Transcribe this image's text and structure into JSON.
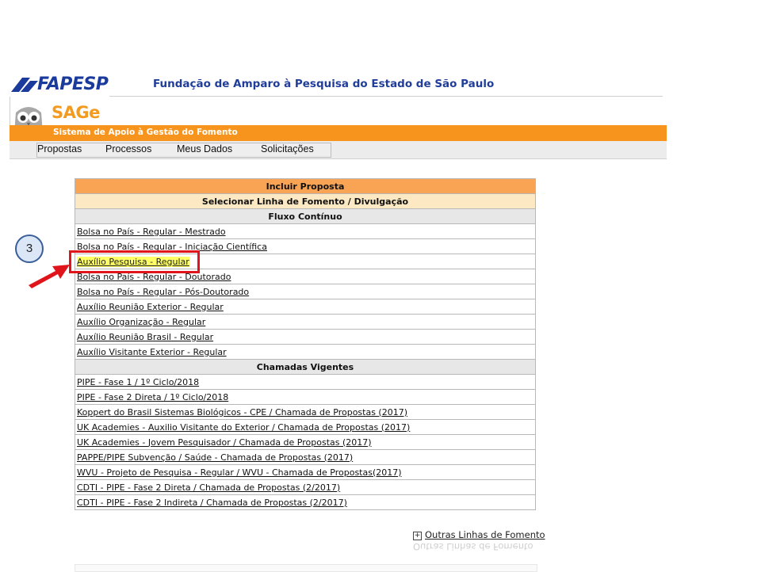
{
  "header": {
    "logo_text": "FAPESP",
    "foundation_title": "Fundação de Amparo à Pesquisa do Estado de São Paulo",
    "app_name": "SAGe",
    "app_subtitle": "Sistema de Apoio à Gestão do Fomento"
  },
  "menu": {
    "items": [
      "Propostas",
      "Processos",
      "Meus Dados",
      "Solicitações"
    ]
  },
  "table": {
    "title": "Incluir Proposta",
    "subtitle": "Selecionar Linha de Fomento / Divulgação",
    "section_fluxo": "Fluxo Contínuo",
    "fluxo_items": [
      "Bolsa no País - Regular - Mestrado",
      "Bolsa no País - Regular - Iniciação Científica",
      "Auxílio Pesquisa - Regular",
      "Bolsa no País - Regular - Doutorado",
      "Bolsa no País - Regular - Pós-Doutorado",
      "Auxílio Reunião Exterior - Regular",
      "Auxílio Organização - Regular",
      "Auxílio Reunião Brasil - Regular",
      "Auxílio Visitante Exterior - Regular"
    ],
    "section_chamadas": "Chamadas Vigentes",
    "chamadas_items": [
      "PIPE - Fase 1 / 1º Ciclo/2018",
      "PIPE - Fase 2 Direta / 1º Ciclo/2018",
      "Koppert do Brasil Sistemas Biológicos - CPE / Chamada de Propostas (2017)",
      "UK Academies - Auxilio Visitante do Exterior / Chamada de Propostas (2017)",
      "UK Academies - Jovem Pesquisador / Chamada de Propostas (2017)",
      "PAPPE/PIPE Subvenção / Saúde - Chamada de Propostas (2017)",
      "WVU - Projeto de Pesquisa - Regular / WVU - Chamada de Propostas(2017)",
      "CDTI - PIPE - Fase 2 Direta / Chamada de Propostas (2/2017)",
      "CDTI - PIPE - Fase 2 Indireta / Chamada de Propostas (2/2017)"
    ]
  },
  "annotation": {
    "step_number": "3",
    "highlight_color": "#e0151b"
  },
  "footer": {
    "more_lines_label": "Outras Linhas de Fomento"
  },
  "colors": {
    "brand_blue": "#1a3a9c",
    "brand_orange": "#f7941d",
    "header_orange": "#f8a454",
    "header_cream": "#fce9c4"
  }
}
